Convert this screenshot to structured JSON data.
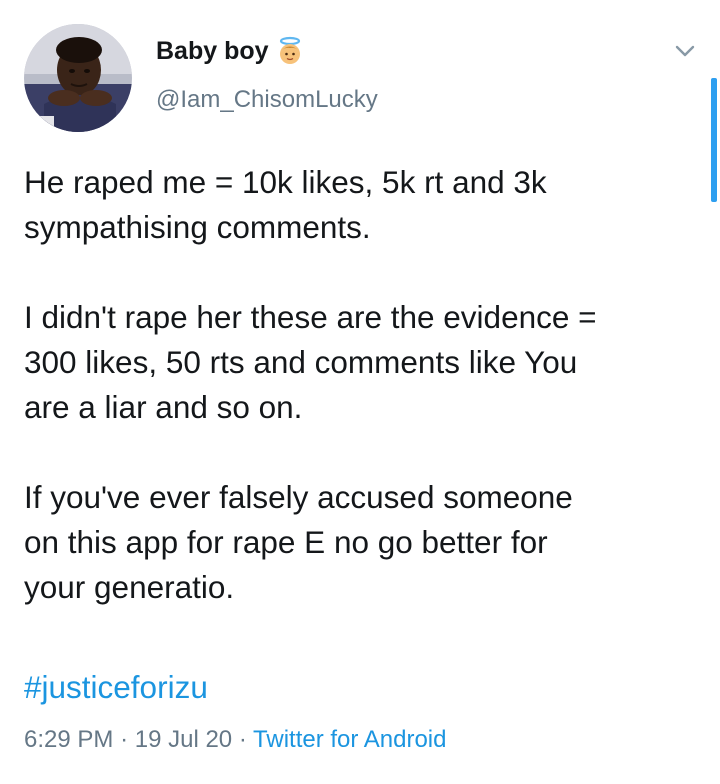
{
  "author": {
    "display_name": "Baby boy",
    "name_emoji": "angel-baby-emoji",
    "handle": "@Iam_ChisomLucky",
    "avatar": "profile-photo"
  },
  "tweet": {
    "paragraphs": [
      "He raped me = 10k likes, 5k rt and  3k\nsympathising comments.",
      "I didn't rape her these are the evidence =\n300 likes, 50 rts and comments like You\nare a liar and so on.",
      "If you've ever falsely accused someone\non this app for rape E no go better for\nyour generatio."
    ],
    "hashtag": "#justiceforizu"
  },
  "meta": {
    "time": "6:29 PM",
    "separator": "·",
    "date": "19 Jul 20",
    "source": "Twitter for Android"
  },
  "icons": {
    "menu": "chevron-down-icon"
  },
  "colors": {
    "text": "#14171a",
    "secondary": "#657786",
    "link": "#1b95e0",
    "scrollbar": "#2e9ff0"
  }
}
